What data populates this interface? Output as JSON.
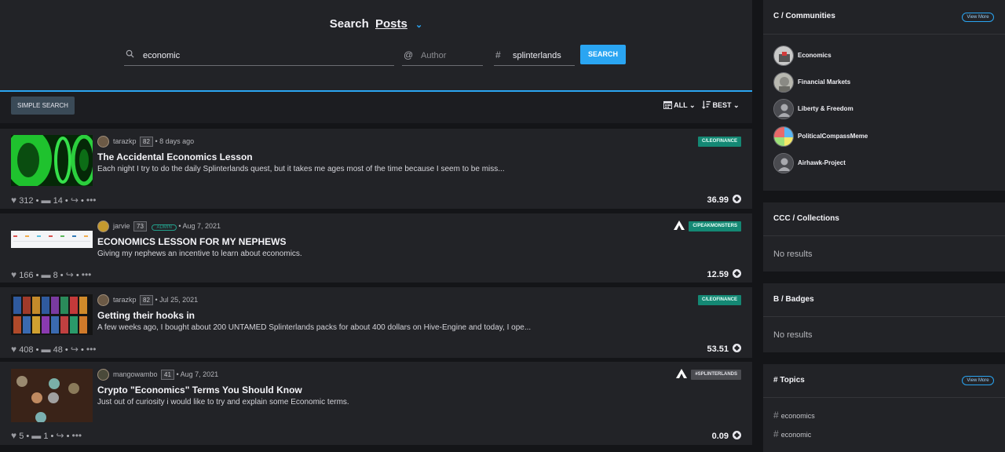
{
  "search": {
    "title": "Search",
    "mode": "Posts",
    "query": "economic",
    "author_placeholder": "Author",
    "tag": "splinterlands",
    "button": "SEARCH"
  },
  "toolbar": {
    "simple_search": "SIMPLE SEARCH",
    "time_filter": "ALL",
    "sort": "BEST"
  },
  "posts": [
    {
      "author": "tarazkp",
      "reputation": "82",
      "age": "8 days ago",
      "title": "The Accidental Economics Lesson",
      "excerpt": "Each night I try to do the daily Splinterlands quest, but it takes me ages most of the time because I seem to be miss...",
      "community": "C/LEOFINANCE",
      "votes": "312",
      "comments": "14",
      "payout": "36.99"
    },
    {
      "author": "jarvie",
      "reputation": "73",
      "badge": "ADMIN",
      "age": "Aug 7, 2021",
      "title": "ECONOMICS LESSON FOR MY NEPHEWS",
      "excerpt": "Giving my nephews an incentive to learn about economics.",
      "community": "C/PEAKMONSTERS",
      "votes": "166",
      "comments": "8",
      "payout": "12.59"
    },
    {
      "author": "tarazkp",
      "reputation": "82",
      "age": "Jul 25, 2021",
      "title": "Getting their hooks in",
      "excerpt": "A few weeks ago, I bought about 200 UNTAMED Splinterlands packs for about 400 dollars on Hive-Engine and today, I ope...",
      "community": "C/LEOFINANCE",
      "votes": "408",
      "comments": "48",
      "payout": "53.51"
    },
    {
      "author": "mangowambo",
      "reputation": "41",
      "age": "Aug 7, 2021",
      "title": "Crypto \"Economics\" Terms You Should Know",
      "excerpt": "Just out of curiosity i would like to try and explain some Economic terms.",
      "community": "#SPLINTERLANDS",
      "votes": "5",
      "comments": "1",
      "payout": "0.09"
    }
  ],
  "sidebar": {
    "communities": {
      "title": "C / Communities",
      "view_more": "View More",
      "items": [
        "Economics",
        "Financial Markets",
        "Liberty & Freedom",
        "PoliticalCompassMeme",
        "Airhawk-Project"
      ]
    },
    "collections": {
      "title": "CCC / Collections",
      "empty": "No results"
    },
    "badges": {
      "title": "B / Badges",
      "empty": "No results"
    },
    "topics": {
      "title": "# Topics",
      "view_more": "View More",
      "items": [
        "economics",
        "economic"
      ]
    }
  },
  "colors": {
    "accent": "#2aa5f2",
    "community_badge": "#148874",
    "panel": "#222327",
    "background": "#141518"
  }
}
